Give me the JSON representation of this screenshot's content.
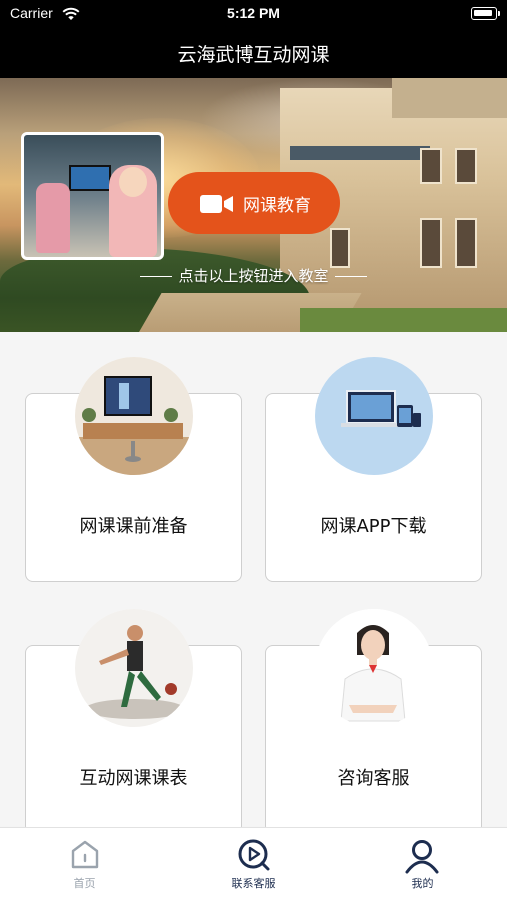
{
  "status": {
    "carrier": "Carrier",
    "time": "5:12 PM"
  },
  "nav": {
    "title": "云海武博互动网课"
  },
  "banner": {
    "button_label": "网课教育",
    "hint": "点击以上按钮进入教室"
  },
  "cards": [
    {
      "label": "网课课前准备"
    },
    {
      "label": "网课APP下载"
    },
    {
      "label": "互动网课课表"
    },
    {
      "label": "咨询客服"
    }
  ],
  "tabbar": {
    "items": [
      {
        "label": "首页",
        "icon": "home-icon",
        "color": "#9aa3ad"
      },
      {
        "label": "联系客服",
        "icon": "play-circle-icon",
        "color": "#1d2d4f"
      },
      {
        "label": "我的",
        "icon": "user-icon",
        "color": "#1d2d4f"
      }
    ]
  },
  "colors": {
    "accent": "#e4531b",
    "nav": "#000000"
  }
}
